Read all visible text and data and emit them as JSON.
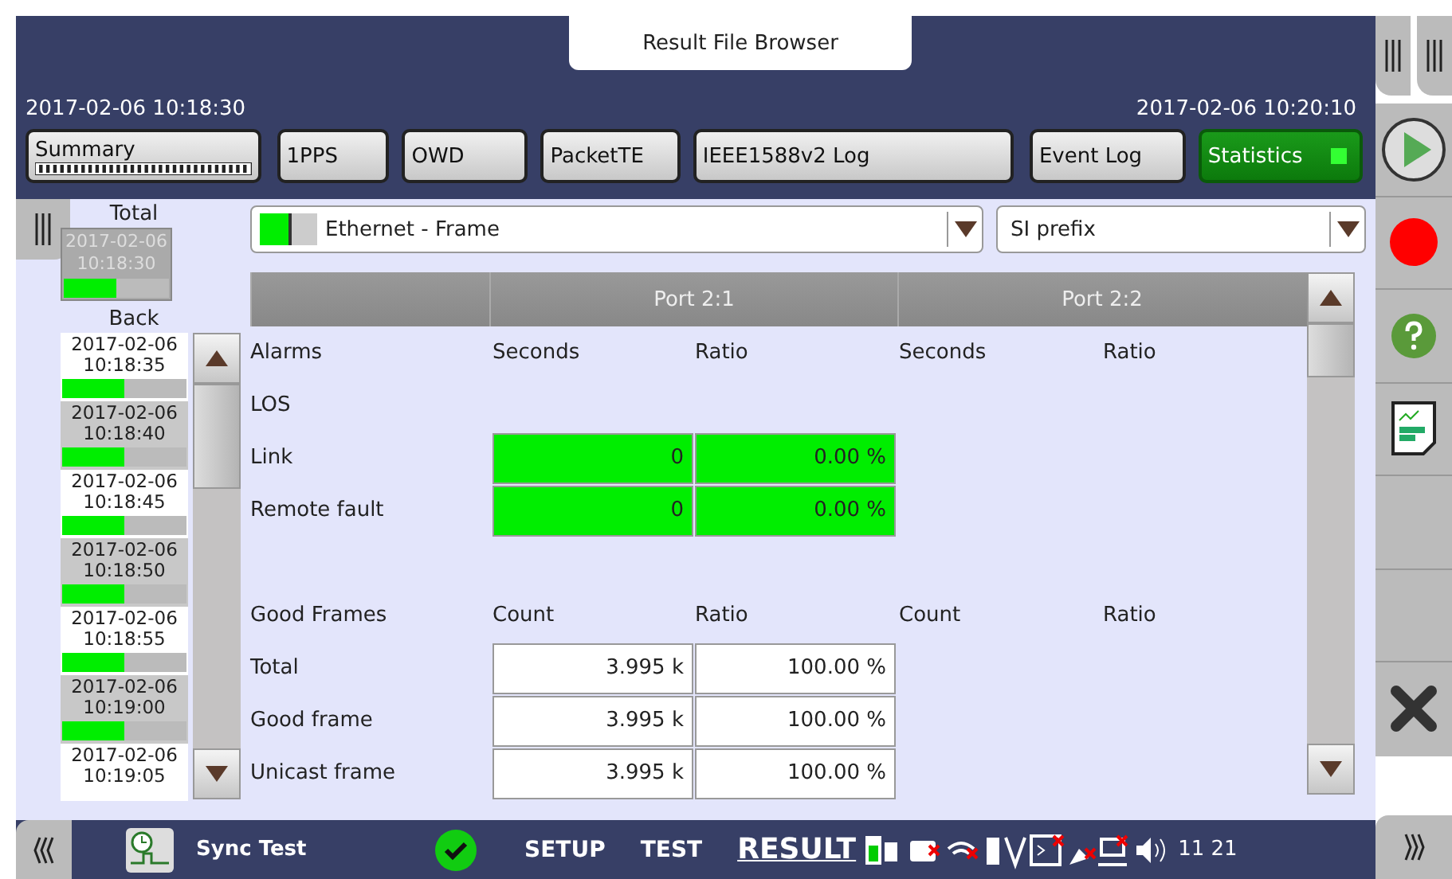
{
  "window": {
    "title": "Result File Browser"
  },
  "time_range": {
    "start": "2017-02-06 10:18:30",
    "end": "2017-02-06 10:20:10"
  },
  "tabs": [
    {
      "label": "Summary",
      "selected": false,
      "kind": "progress"
    },
    {
      "label": "1PPS",
      "selected": false,
      "kind": "plain"
    },
    {
      "label": "OWD",
      "selected": false,
      "kind": "plain"
    },
    {
      "label": "PacketTE",
      "selected": false,
      "kind": "plain"
    },
    {
      "label": "IEEE1588v2 Log",
      "selected": false,
      "kind": "plain"
    },
    {
      "label": "Event Log",
      "selected": false,
      "kind": "plain"
    },
    {
      "label": "Statistics",
      "selected": true,
      "kind": "indicator"
    }
  ],
  "total": {
    "label": "Total",
    "date": "2017-02-06",
    "time": "10:18:30",
    "level": 0.5
  },
  "back": {
    "label": "Back",
    "items": [
      {
        "date": "2017-02-06",
        "time": "10:18:35",
        "level": 0.5
      },
      {
        "date": "2017-02-06",
        "time": "10:18:40",
        "level": 0.5
      },
      {
        "date": "2017-02-06",
        "time": "10:18:45",
        "level": 0.5
      },
      {
        "date": "2017-02-06",
        "time": "10:18:50",
        "level": 0.5
      },
      {
        "date": "2017-02-06",
        "time": "10:18:55",
        "level": 0.5
      },
      {
        "date": "2017-02-06",
        "time": "10:19:00",
        "level": 0.5
      },
      {
        "date": "2017-02-06",
        "time": "10:19:05"
      }
    ]
  },
  "selectors": [
    {
      "kind": "status",
      "value": "Ethernet - Frame"
    },
    {
      "kind": "plain",
      "value": "SI prefix"
    }
  ],
  "table": {
    "ports": [
      "Port 2:1",
      "Port 2:2"
    ],
    "sections": [
      {
        "title": "Alarms",
        "columns": [
          "Seconds",
          "Ratio",
          "Seconds",
          "Ratio"
        ],
        "rows": [
          {
            "label": "LOS",
            "kind": "empty",
            "cells": []
          },
          {
            "label": "Link",
            "kind": "alarm",
            "cells": [
              "0",
              "0.00 %"
            ]
          },
          {
            "label": "Remote fault",
            "kind": "alarm",
            "cells": [
              "0",
              "0.00 %"
            ]
          }
        ]
      },
      {
        "title": "Good Frames",
        "columns": [
          "Count",
          "Ratio",
          "Count",
          "Ratio"
        ],
        "rows": [
          {
            "label": "Total",
            "kind": "count",
            "cells": [
              "3.995 k",
              "100.00 %"
            ]
          },
          {
            "label": "Good frame",
            "kind": "count",
            "cells": [
              "3.995 k",
              "100.00 %"
            ]
          },
          {
            "label": "Unicast frame",
            "kind": "count",
            "cells": [
              "3.995 k",
              "100.00 %"
            ]
          }
        ]
      }
    ]
  },
  "status_bar": {
    "app": "Sync Test",
    "status_ok": true,
    "nav": [
      {
        "label": "SETUP",
        "selected": false
      },
      {
        "label": "TEST",
        "selected": false
      },
      {
        "label": "RESULT",
        "selected": true
      }
    ],
    "clock": "11 21"
  }
}
